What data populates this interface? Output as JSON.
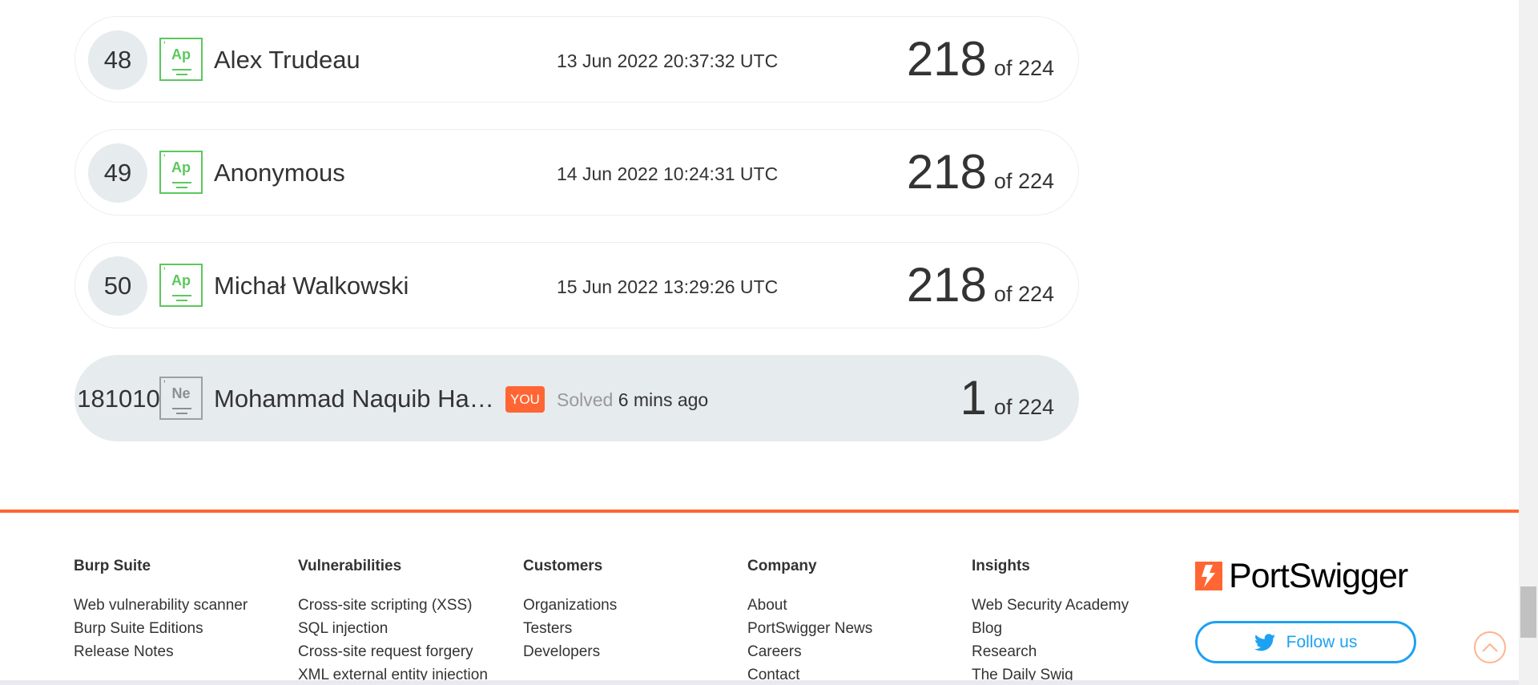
{
  "leaderboard": {
    "rows": [
      {
        "rank": "48",
        "level_symbol": "Ap",
        "level_tick": "'",
        "name": "Alex Trudeau",
        "date": "13 Jun 2022 20:37:32 UTC",
        "score": "218",
        "of_total": "of 224"
      },
      {
        "rank": "49",
        "level_symbol": "Ap",
        "level_tick": "'",
        "name": "Anonymous",
        "date": "14 Jun 2022 10:24:31 UTC",
        "score": "218",
        "of_total": "of 224"
      },
      {
        "rank": "50",
        "level_symbol": "Ap",
        "level_tick": "'",
        "name": "Michał Walkowski",
        "date": "15 Jun 2022 13:29:26 UTC",
        "score": "218",
        "of_total": "of 224"
      }
    ],
    "me": {
      "rank": "181010",
      "level_symbol": "Ne",
      "level_tick": "'",
      "name": "Mohammad Naquib Ha…",
      "you_badge": "YOU",
      "solved_label": "Solved",
      "solved_time": "6 mins ago",
      "score": "1",
      "of_total": "of 224"
    }
  },
  "footer": {
    "columns": [
      {
        "heading": "Burp Suite",
        "links": [
          "Web vulnerability scanner",
          "Burp Suite Editions",
          "Release Notes"
        ]
      },
      {
        "heading": "Vulnerabilities",
        "links": [
          "Cross-site scripting (XSS)",
          "SQL injection",
          "Cross-site request forgery",
          "XML external entity injection"
        ]
      },
      {
        "heading": "Customers",
        "links": [
          "Organizations",
          "Testers",
          "Developers"
        ]
      },
      {
        "heading": "Company",
        "links": [
          "About",
          "PortSwigger News",
          "Careers",
          "Contact"
        ]
      },
      {
        "heading": "Insights",
        "links": [
          "Web Security Academy",
          "Blog",
          "Research",
          "The Daily Swig"
        ]
      }
    ],
    "logo_text": "PortSwigger",
    "follow_label": "Follow us"
  },
  "colors": {
    "accent": "#ff6633",
    "level_apprentice": "#5cc85c",
    "level_novice": "#9aa0a6",
    "twitter": "#1da1f2",
    "row_me_bg": "#e6ebee"
  },
  "icons": {
    "level_badge": "level-badge-icon",
    "twitter": "twitter-bird-icon",
    "scroll_top": "chevron-up-icon",
    "logo": "portswigger-logo-icon"
  }
}
